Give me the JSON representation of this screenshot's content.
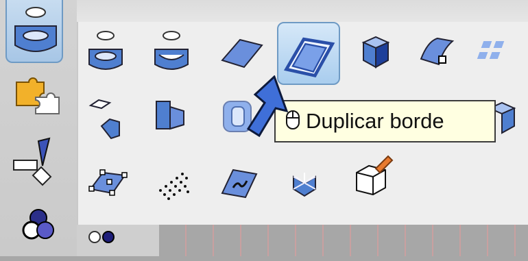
{
  "tooltip": {
    "text": "Duplicar borde",
    "icon": "mouse-icon"
  },
  "left_toolbar": {
    "items": [
      {
        "icon": "surface-cylinder-icon",
        "active": true
      },
      {
        "icon": "puzzle-pieces-icon",
        "active": false
      },
      {
        "icon": "transform-icon",
        "active": false
      },
      {
        "icon": "color-circles-icon",
        "active": false
      }
    ]
  },
  "flyout": {
    "rows": [
      [
        "surface-tube-icon",
        "surface-tube-open-icon",
        "plane-surface-icon",
        "duplicate-edge-icon",
        "box-solid-icon",
        "curve-surface-icon",
        "grid-points-icon"
      ],
      [
        "split-surface-icon",
        "extrude-surface-icon",
        "solid-cap-icon",
        "box-frame-icon"
      ],
      [
        "control-points-icon",
        "point-cloud-icon",
        "text-surface-icon",
        "star-solid-icon",
        "box-wireframe-edit-icon"
      ]
    ],
    "selected": "duplicate-edge-icon"
  },
  "colors": {
    "accent": "#6e9ac4",
    "tooltip_bg": "#ffffe1",
    "cursor": "#3f6fd8"
  }
}
